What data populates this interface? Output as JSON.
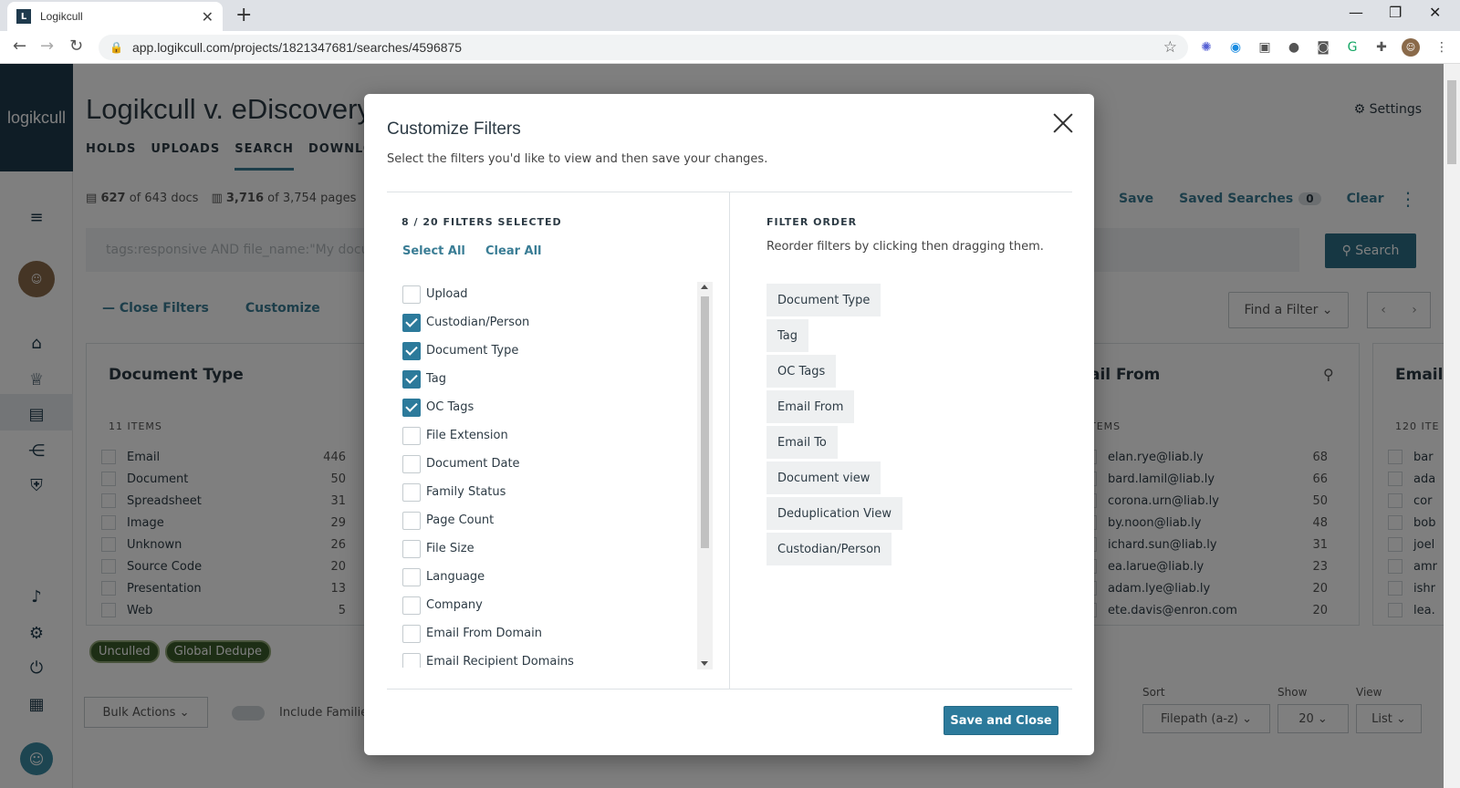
{
  "browser": {
    "tab_title": "Logikcull",
    "favicon_letter": "L",
    "url": "app.logikcull.com/projects/1821347681/searches/4596875"
  },
  "app": {
    "logo": "logikcull",
    "project_title": "Logikcull v. eDiscovery",
    "nav": [
      "HOLDS",
      "UPLOADS",
      "SEARCH",
      "DOWNLOADS"
    ],
    "settings": "Settings",
    "stats": {
      "docs_count": "627",
      "docs_total": "of 643 docs",
      "pages_count": "3,716",
      "pages_total": "of 3,754 pages"
    },
    "actions": {
      "save": "Save",
      "saved_searches": "Saved Searches",
      "saved_count": "0",
      "clear": "Clear"
    },
    "search_placeholder": "tags:responsive AND file_name:\"My documen",
    "search_button": "Search",
    "close_filters": "— Close Filters",
    "customize": "Customize",
    "find_filter": "Find a Filter",
    "cards": {
      "doc_type": {
        "title": "Document Type",
        "count": "11 ITEMS",
        "rows": [
          {
            "label": "Email",
            "n": "446"
          },
          {
            "label": "Document",
            "n": "50"
          },
          {
            "label": "Spreadsheet",
            "n": "31"
          },
          {
            "label": "Image",
            "n": "29"
          },
          {
            "label": "Unknown",
            "n": "26"
          },
          {
            "label": "Source Code",
            "n": "20"
          },
          {
            "label": "Presentation",
            "n": "13"
          },
          {
            "label": "Web",
            "n": "5"
          }
        ]
      },
      "email_from": {
        "title": "ail From",
        "count": "TEMS",
        "rows": [
          {
            "label": "elan.rye@liab.ly",
            "n": "68"
          },
          {
            "label": "bard.lamil@liab.ly",
            "n": "66"
          },
          {
            "label": "corona.urn@liab.ly",
            "n": "50"
          },
          {
            "label": "by.noon@liab.ly",
            "n": "48"
          },
          {
            "label": "ichard.sun@liab.ly",
            "n": "31"
          },
          {
            "label": "ea.larue@liab.ly",
            "n": "23"
          },
          {
            "label": "adam.lye@liab.ly",
            "n": "20"
          },
          {
            "label": "ete.davis@enron.com",
            "n": "20"
          }
        ]
      },
      "email": {
        "title": "Email",
        "count": "120 ITE",
        "rows": [
          {
            "label": "bar"
          },
          {
            "label": "ada"
          },
          {
            "label": "cor"
          },
          {
            "label": "bob"
          },
          {
            "label": "joel"
          },
          {
            "label": "amr"
          },
          {
            "label": "ishr"
          },
          {
            "label": "lea."
          }
        ]
      }
    },
    "tag_pills": [
      "Unculled",
      "Global Dedupe"
    ],
    "bulk_actions": "Bulk Actions",
    "include_families": "Include Familie",
    "sort_label": "Sort",
    "sort_value": "Filepath (a-z)",
    "show_label": "Show",
    "show_value": "20",
    "view_label": "View",
    "view_value": "List"
  },
  "modal": {
    "title": "Customize Filters",
    "subtitle": "Select the filters you'd like to view and then save your changes.",
    "selected_count": "8 / 20 FILTERS SELECTED",
    "select_all": "Select All",
    "clear_all": "Clear All",
    "filters": [
      {
        "label": "Upload",
        "checked": false
      },
      {
        "label": "Custodian/Person",
        "checked": true
      },
      {
        "label": "Document Type",
        "checked": true
      },
      {
        "label": "Tag",
        "checked": true
      },
      {
        "label": "OC Tags",
        "checked": true
      },
      {
        "label": "File Extension",
        "checked": false
      },
      {
        "label": "Document Date",
        "checked": false
      },
      {
        "label": "Family Status",
        "checked": false
      },
      {
        "label": "Page Count",
        "checked": false
      },
      {
        "label": "File Size",
        "checked": false
      },
      {
        "label": "Language",
        "checked": false
      },
      {
        "label": "Company",
        "checked": false
      },
      {
        "label": "Email From Domain",
        "checked": false
      },
      {
        "label": "Email Recipient Domains",
        "checked": false
      }
    ],
    "order_title": "FILTER ORDER",
    "order_subtitle": "Reorder filters by clicking then dragging them.",
    "order": [
      "Document Type",
      "Tag",
      "OC Tags",
      "Email From",
      "Email To",
      "Document view",
      "Deduplication View",
      "Custodian/Person"
    ],
    "save_close": "Save and Close"
  }
}
